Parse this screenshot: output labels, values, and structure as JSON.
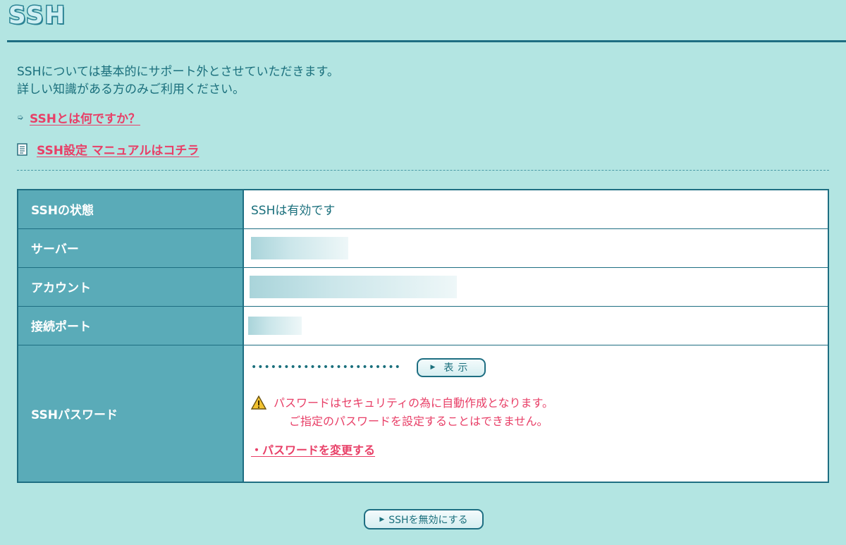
{
  "page": {
    "logo_text": "SSH",
    "intro_line1": "SSHについては基本的にサポート外とさせていただきます。",
    "intro_line2": "詳しい知識がある方のみご利用ください。",
    "link_what_is_ssh": "SSHとは何ですか？",
    "link_manual": "SSH設定 マニュアルはコチラ"
  },
  "table": {
    "rows": [
      {
        "label": "SSHの状態",
        "value": "SSHは有効です"
      },
      {
        "label": "サーバー",
        "value": ""
      },
      {
        "label": "アカウント",
        "value": ""
      },
      {
        "label": "接続ポート",
        "value": ""
      },
      {
        "label": "SSHパスワード",
        "value": ""
      }
    ],
    "password_masked": "•••••••••••••••••••••••",
    "show_button": "表示",
    "warning_line1": "パスワードはセキュリティの為に自動作成となります。",
    "warning_line2": "ご指定のパスワードを設定することはできません。",
    "change_password_link": "・パスワードを変更する"
  },
  "footer": {
    "disable_button": "SSHを無効にする"
  },
  "colors": {
    "background": "#b3e5e2",
    "header_cell": "#5aabb8",
    "border": "#1e6e82",
    "link": "#e83f67",
    "text": "#1a6f7c"
  },
  "icons": {
    "arrow": "arrow-icon",
    "manual": "document-icon",
    "warning": "warning-icon"
  }
}
